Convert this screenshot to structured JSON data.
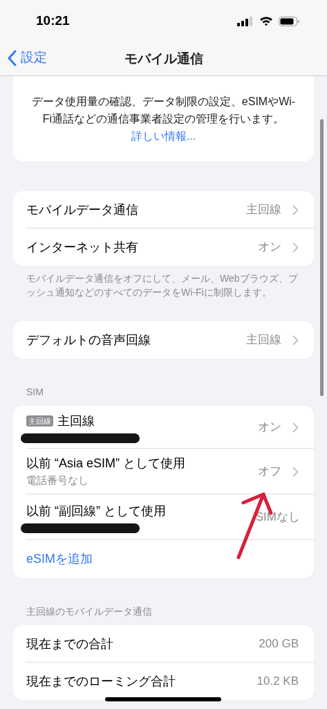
{
  "status_bar": {
    "time": "10:21"
  },
  "nav": {
    "back_label": "設定",
    "title": "モバイル通信"
  },
  "intro": {
    "text": "データ使用量の確認、データ制限の設定、eSIMやWi-Fi通話などの通信事業者設定の管理を行います。",
    "link": "詳しい情報..."
  },
  "sections": [
    {
      "rows": [
        {
          "kind": "detail",
          "label": "モバイルデータ通信",
          "value": "主回線",
          "chevron": true
        },
        {
          "kind": "detail",
          "label": "インターネット共有",
          "value": "オン",
          "chevron": true
        }
      ],
      "footer": "モバイルデータ通信をオフにして、メール、Webブラウズ、プッシュ通知などのすべてのデータをWi-Fiに制限します。"
    },
    {
      "rows": [
        {
          "kind": "detail",
          "label": "デフォルトの音声回線",
          "value": "主回線",
          "chevron": true
        }
      ]
    },
    {
      "header": "SIM",
      "rows": [
        {
          "kind": "sim",
          "badge": "主回線",
          "label": "主回線",
          "redacted": true,
          "value": "オン",
          "chevron": true
        },
        {
          "kind": "sim",
          "label": "以前 “Asia eSIM” として使用",
          "subtitle": "電話番号なし",
          "value": "オフ",
          "chevron": true
        },
        {
          "kind": "sim",
          "label": "以前 “副回線” として使用",
          "redacted": true,
          "value": "SIMなし",
          "chevron": false
        },
        {
          "kind": "link",
          "label": "eSIMを追加"
        }
      ]
    },
    {
      "header": "主回線のモバイルデータ通信",
      "rows": [
        {
          "kind": "detail",
          "label": "現在までの合計",
          "value": "200 GB",
          "chevron": false
        },
        {
          "kind": "detail",
          "label": "現在までのローミング合計",
          "value": "10.2 KB",
          "chevron": false
        }
      ]
    }
  ]
}
